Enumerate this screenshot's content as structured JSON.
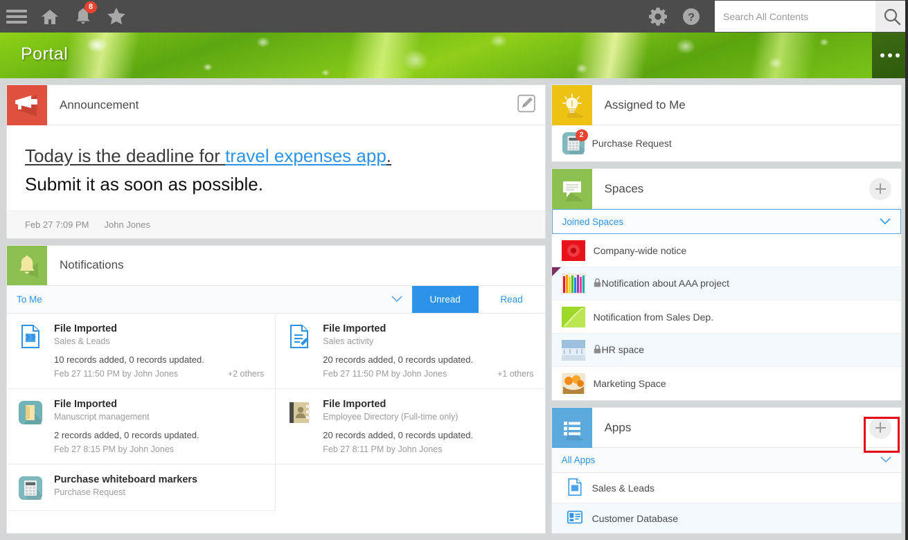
{
  "topbar": {
    "menu_icon": "hamburger-icon",
    "home_icon": "home-icon",
    "bell_icon": "bell-icon",
    "bell_badge": "8",
    "star_icon": "star-icon",
    "gear_icon": "gear-icon",
    "help_icon": "help-icon",
    "search_placeholder": "Search All Contents",
    "search_value": "",
    "search_icon": "magnifier-icon"
  },
  "banner": {
    "title": "Portal",
    "overflow_icon": "ellipsis-icon"
  },
  "announcement": {
    "icon": "megaphone-icon",
    "title": "Announcement",
    "edit_icon": "edit-pencil-icon",
    "line1_prefix": "Today is the deadline for ",
    "line1_link": "travel expenses app",
    "line1_suffix": ".",
    "line2": "Submit it as soon as possible.",
    "date": "Feb 27 7:09 PM",
    "author": "John Jones"
  },
  "notifications": {
    "icon": "bell-icon",
    "title": "Notifications",
    "filter_label": "To Me",
    "filter_chevron": "chevron-down-icon",
    "tab_unread": "Unread",
    "tab_read": "Read",
    "active_tab": "Unread",
    "items": [
      {
        "icon": "file-app-blue-icon",
        "title": "File Imported",
        "source": "Sales & Leads",
        "description": "10 records added, 0 records updated.",
        "meta": "Feb 27 11:50 PM  by John Jones",
        "others": "+2 others"
      },
      {
        "icon": "file-edit-blue-icon",
        "title": "File Imported",
        "source": "Sales activity",
        "description": "20 records added, 0 records updated.",
        "meta": "Feb 27 11:50 PM  by John Jones",
        "others": "+1 others"
      },
      {
        "icon": "folder-teal-icon",
        "title": "File Imported",
        "source": "Manuscript management",
        "description": "2 records added, 0 records updated.",
        "meta": "Feb 27 8:15 PM  by John Jones",
        "others": ""
      },
      {
        "icon": "address-book-icon",
        "title": "File Imported",
        "source": "Employee Directory (Full-time only)",
        "description": "20 records added, 0 records updated.",
        "meta": "Feb 27 8:11 PM  by John Jones",
        "others": ""
      },
      {
        "icon": "calculator-teal-icon",
        "title": "Purchase whiteboard markers",
        "source": "Purchase Request",
        "description": "",
        "meta": "",
        "others": ""
      }
    ]
  },
  "assigned": {
    "icon": "lightbulb-icon",
    "title": "Assigned to Me",
    "items": [
      {
        "icon": "calculator-teal-icon",
        "label": "Purchase Request",
        "badge": "2"
      }
    ]
  },
  "spaces": {
    "icon": "speech-bubble-icon",
    "title": "Spaces",
    "add_icon": "plus-icon",
    "filter_label": "Joined Spaces",
    "filter_chevron": "chevron-down-icon",
    "items": [
      {
        "thumb": "red-flower-thumb",
        "label": "Company-wide notice",
        "locked": false,
        "flagged": false
      },
      {
        "thumb": "colored-pencils-thumb",
        "label": "Notification about AAA project",
        "locked": true,
        "flagged": true
      },
      {
        "thumb": "green-leaf-thumb",
        "label": "Notification from Sales Dep.",
        "locked": false,
        "flagged": false
      },
      {
        "thumb": "snow-landscape-thumb",
        "label": "HR space",
        "locked": true,
        "flagged": false
      },
      {
        "thumb": "oranges-basket-thumb",
        "label": "Marketing Space",
        "locked": false,
        "flagged": false
      }
    ]
  },
  "apps": {
    "icon": "list-blue-icon",
    "title": "Apps",
    "add_icon": "plus-icon",
    "add_highlighted": true,
    "filter_label": "All Apps",
    "filter_chevron": "chevron-down-icon",
    "items": [
      {
        "icon": "file-app-blue-icon",
        "label": "Sales & Leads"
      },
      {
        "icon": "id-card-blue-icon",
        "label": "Customer Database"
      }
    ]
  },
  "colors": {
    "accent_blue": "#2d93e8",
    "topbar_gray": "#4c4c4c",
    "badge_red": "#e8442f",
    "highlight_red": "#e60012",
    "page_bg": "#d4d7d8"
  }
}
